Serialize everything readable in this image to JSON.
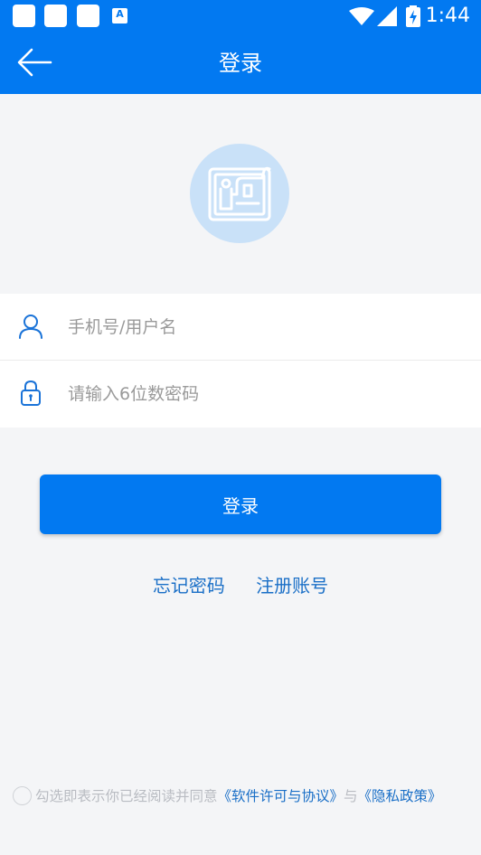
{
  "status_bar": {
    "time": "1:44",
    "notification_icons": [
      "notification-icon",
      "notification-icon",
      "notification-icon",
      "app-a-icon"
    ],
    "app_badge_letter": "A",
    "system_icons": [
      "wifi-icon",
      "signal-icon",
      "battery-charging-icon"
    ]
  },
  "header": {
    "title": "登录",
    "back_icon": "arrow-left-icon"
  },
  "logo": {
    "icon": "app-logo-icon"
  },
  "form": {
    "username": {
      "placeholder": "手机号/用户名",
      "value": "",
      "icon": "user-icon"
    },
    "password": {
      "placeholder": "请输入6位数密码",
      "value": "",
      "icon": "lock-icon"
    }
  },
  "login_button": {
    "label": "登录"
  },
  "links": {
    "forgot_password": "忘记密码",
    "register": "注册账号"
  },
  "agreement": {
    "text": "勾选即表示你已经阅读并同意",
    "license_link": "《软件许可与协议》",
    "conjunction": "与",
    "privacy_link": "《隐私政策》",
    "checked": false
  },
  "colors": {
    "primary": "#0279f1",
    "background": "#f4f5f7",
    "link": "#1a6fc7",
    "logo_bg": "#c9e1f8"
  }
}
